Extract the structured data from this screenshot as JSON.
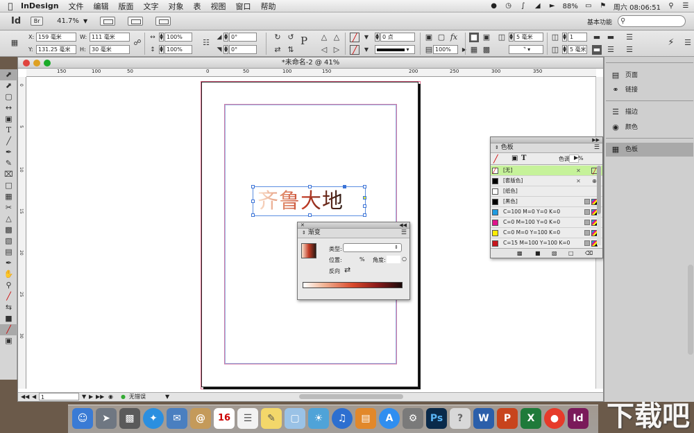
{
  "menubar": {
    "app_name": "InDesign",
    "menus": [
      "文件",
      "编辑",
      "版面",
      "文字",
      "对象",
      "表",
      "视图",
      "窗口",
      "帮助"
    ],
    "battery": "88%",
    "clock": "周六 08:06:51"
  },
  "appbar": {
    "logo": "Id",
    "bridge": "Br",
    "zoom": "41.7%",
    "workspace": "基本功能",
    "search_placeholder": ""
  },
  "control": {
    "x_label": "X:",
    "x_value": "159 毫米",
    "y_label": "Y:",
    "y_value": "131.25 毫米",
    "w_label": "W:",
    "w_value": "111 毫米",
    "h_label": "H:",
    "h_value": "30 毫米",
    "scale_x": "100%",
    "scale_y": "100%",
    "rotate": "0°",
    "shear": "0°",
    "stroke_weight": "0 点",
    "opacity": "100%",
    "col_count": "1",
    "gap_1": "5 毫米",
    "gap_2": "5 毫米"
  },
  "document": {
    "title": "*未命名-2 @ 41%",
    "ruler_h": [
      "150",
      "100",
      "50",
      "0",
      "50",
      "100",
      "150",
      "200",
      "250",
      "300",
      "350"
    ],
    "ruler_v": [
      "0",
      "5",
      "10",
      "15",
      "20",
      "25",
      "30"
    ],
    "frame_text": "齐鲁大地",
    "page_number": "1",
    "status": "无错误"
  },
  "gradient_panel": {
    "title": "渐变",
    "type_label": "类型:",
    "position_label": "位置:",
    "percent": "%",
    "angle_label": "角度:",
    "reverse_label": "反向"
  },
  "swatches_panel": {
    "title": "色板",
    "tint_label": "色调:",
    "tint_percent": "%",
    "rows": [
      {
        "name": "[无]",
        "color": "#ffffff",
        "selected": true
      },
      {
        "name": "[套版色]",
        "color": "#000000",
        "selected": false
      },
      {
        "name": "[纸色]",
        "color": "#ffffff",
        "selected": false
      },
      {
        "name": "[黑色]",
        "color": "#000000",
        "selected": false
      },
      {
        "name": "C=100 M=0 Y=0 K=0",
        "color": "#1e9be0",
        "selected": false
      },
      {
        "name": "C=0 M=100 Y=0 K=0",
        "color": "#e0138c",
        "selected": false
      },
      {
        "name": "C=0 M=0 Y=100 K=0",
        "color": "#ffec00",
        "selected": false
      },
      {
        "name": "C=15 M=100 Y=100 K=0",
        "color": "#c8151d",
        "selected": false
      }
    ]
  },
  "dock_panels": [
    {
      "label": "页面",
      "icon": "pages-icon"
    },
    {
      "label": "链接",
      "icon": "links-icon"
    },
    {
      "label": "描边",
      "icon": "stroke-icon"
    },
    {
      "label": "颜色",
      "icon": "color-icon"
    },
    {
      "label": "色板",
      "icon": "swatches-icon"
    }
  ],
  "osdock": {
    "calendar_day": "16"
  },
  "colors": {
    "accent_selected": "#c6f29a",
    "frame_blue": "#3b73d6",
    "bleed_red": "#e06a8a"
  }
}
